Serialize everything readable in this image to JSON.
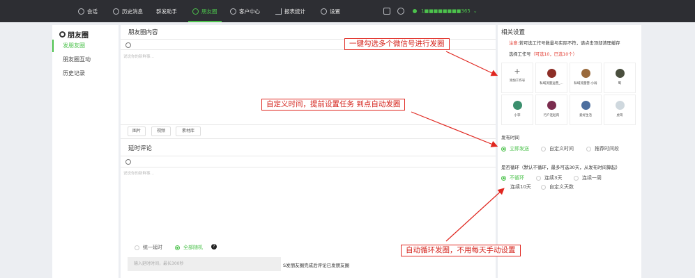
{
  "nav": {
    "items": [
      {
        "label": "会话",
        "icon": "chat-icon"
      },
      {
        "label": "历史消息",
        "icon": "clock-icon"
      },
      {
        "label": "群发助手",
        "icon": ""
      },
      {
        "label": "朋友圈",
        "icon": "moments-icon"
      },
      {
        "label": "客户中心",
        "icon": "user-icon"
      },
      {
        "label": "报表统计",
        "icon": "bar-chart-icon"
      },
      {
        "label": "设置",
        "icon": "gear-icon"
      }
    ],
    "active": "朋友圈",
    "user_phone": "1■■■■■■■■365",
    "accent": "#4cc24c"
  },
  "sidebar": {
    "title": "朋友圈",
    "items": [
      "发朋友圈",
      "朋友圈互动",
      "历史记录"
    ],
    "active": "发朋友圈"
  },
  "main": {
    "content_title": "朋友圈内容",
    "content_placeholder": "说说你的新鲜事…",
    "buttons": [
      "图片",
      "视频",
      "素材库"
    ],
    "delay_title": "延时评论",
    "delay_placeholder": "说说你的新鲜事…",
    "mode_options": [
      "统一延时",
      "全部随机"
    ],
    "mode_selected": "全部随机",
    "delay_input_placeholder": "输入延时时间，最长300秒",
    "delay_note": "S发朋友圈完成后评论已发朋友圈"
  },
  "right": {
    "title": "相关设置",
    "notice_prefix": "注意:",
    "notice_text": "若可选工作号数量与实际不符，请点击顶部清理缓存",
    "select_label": "选择工作号",
    "select_count": "（可选10，已选10个）",
    "accounts": [
      {
        "name": "添加工作号",
        "avatar": "plus"
      },
      {
        "name": "私域流量运营_...",
        "avatar": "#8d2e27"
      },
      {
        "name": "私域流量营-小翁",
        "avatar": "#9a6a3c"
      },
      {
        "name": "鹭",
        "avatar": "#4a4f3e"
      },
      {
        "name": "小李",
        "avatar": "#3b8f6e"
      },
      {
        "name": "行户连起肉",
        "avatar": "#7b2d4f"
      },
      {
        "name": "爱好生活",
        "avatar": "#4c6e9e"
      },
      {
        "name": "虎哥",
        "avatar": "#cfd8de"
      }
    ],
    "publish_label": "发布时间",
    "publish_options": [
      "立即发送",
      "自定义时间",
      "推荐时间段"
    ],
    "publish_selected": "立即发送",
    "loop_label": "是否循环（默认不循环，最多可选30天，从发布时间算起）",
    "loop_options": [
      "不循环",
      "连续3天",
      "连续一周",
      "连续10天",
      "自定义天数"
    ],
    "loop_selected": "不循环"
  },
  "annotations": [
    "一键勾选多个微信号进行发圈",
    "自定义时间，提前设置任务 到点自动发圈",
    "自动循环发圈，不用每天手动设置"
  ],
  "colors": {
    "accent": "#4cc24c",
    "annotation": "#e0261f",
    "topbar": "#2d2e33"
  }
}
